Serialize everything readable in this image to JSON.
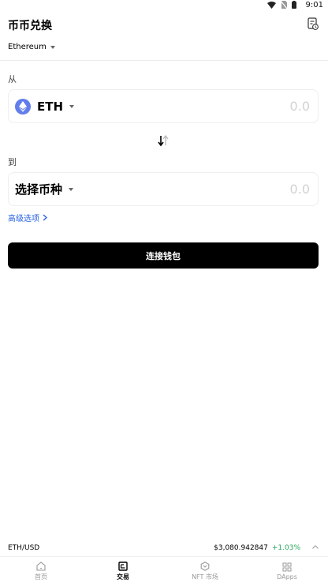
{
  "status_bar": {
    "time": "9:01"
  },
  "header": {
    "title": "币币兑换",
    "history_icon": "history-doc-icon"
  },
  "network": {
    "selected": "Ethereum"
  },
  "from": {
    "label": "从",
    "token": "ETH",
    "amount": "0.0",
    "token_color": "#627eea"
  },
  "swap_icon": "swap-direction-icon",
  "to": {
    "label": "到",
    "token": "选择币种",
    "amount": "0.0"
  },
  "advanced": {
    "label": "高级选项"
  },
  "connect_button": {
    "label": "连接钱包"
  },
  "ticker": {
    "pair": "ETH/USD",
    "price": "$3,080.942847",
    "change": "+1.03%",
    "change_color": "#25a65b"
  },
  "tabs": [
    {
      "label": "首页",
      "icon": "home-icon",
      "active": false
    },
    {
      "label": "交易",
      "icon": "trade-icon",
      "active": true
    },
    {
      "label": "NFT 市场",
      "icon": "nft-icon",
      "active": false
    },
    {
      "label": "DApps",
      "icon": "grid-icon",
      "active": false
    }
  ]
}
